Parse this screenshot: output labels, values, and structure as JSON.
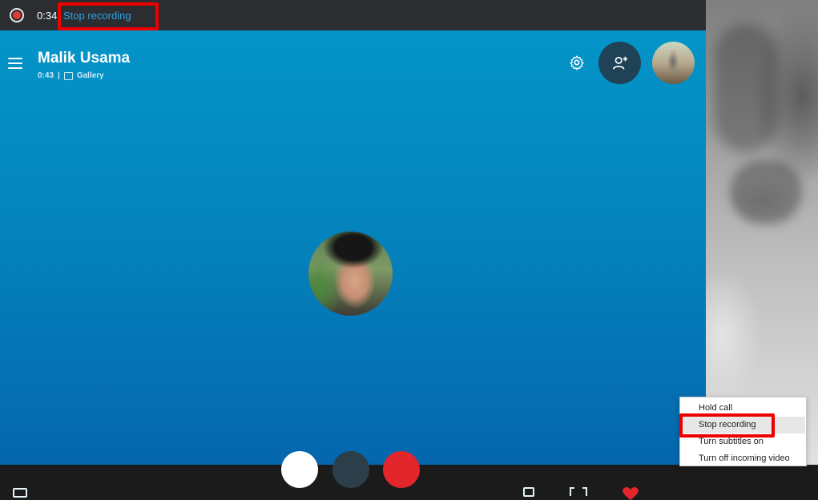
{
  "recording_bar": {
    "elapsed": "0:34",
    "stop_label": "Stop recording"
  },
  "call": {
    "caller_name": "Malik Usama",
    "duration": "0:43",
    "separator": "|",
    "view_mode": "Gallery"
  },
  "context_menu": {
    "items": [
      {
        "label": "Hold call"
      },
      {
        "label": "Stop recording"
      },
      {
        "label": "Turn subtitles on"
      },
      {
        "label": "Turn off incoming video"
      }
    ]
  },
  "icons": {
    "record": "record-icon",
    "menu": "hamburger-icon",
    "settings": "gear-icon",
    "add_participant": "add-person-icon",
    "mic": "microphone-icon",
    "video": "video-icon",
    "end_call": "end-call-icon",
    "react": "heart-icon"
  },
  "colors": {
    "stage_top": "#0495c8",
    "stage_bottom": "#0566ad",
    "recording_link": "#2fa3e6",
    "highlight": "#ee0000",
    "end_call": "#e3262b"
  }
}
